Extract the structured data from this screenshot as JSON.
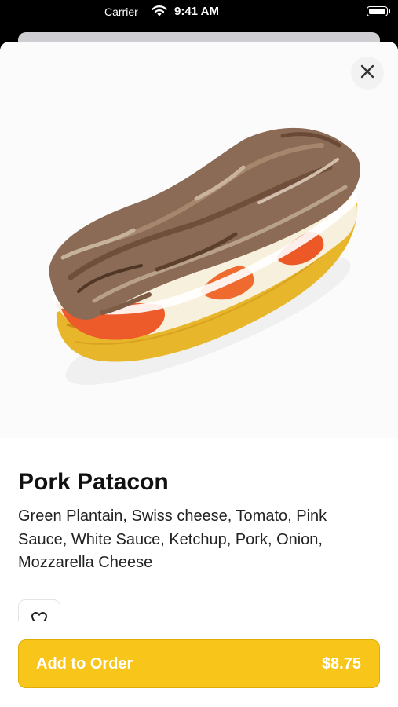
{
  "status_bar": {
    "carrier": "Carrier",
    "time": "9:41 AM"
  },
  "product": {
    "name": "Pork Patacon",
    "description": "Green Plantain, Swiss cheese, Tomato, Pink Sauce, White Sauce, Ketchup, Pork, Onion, Mozzarella Cheese",
    "image_alt": "Pork Patacon"
  },
  "cta": {
    "label": "Add to Order",
    "price": "$8.75"
  },
  "icons": {
    "close": "close-icon",
    "favorite": "heart-icon",
    "wifi": "wifi-icon",
    "battery": "battery-icon"
  },
  "colors": {
    "accent": "#F8C61B",
    "text": "#111111"
  }
}
